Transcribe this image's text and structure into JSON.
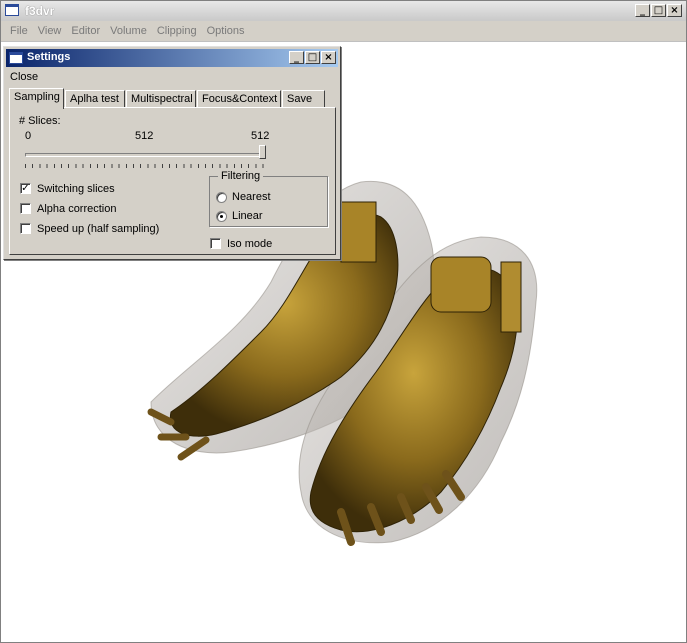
{
  "window": {
    "title": "f3dvr",
    "minimize": "_",
    "maximize": "□",
    "close": "×"
  },
  "menu": [
    "File",
    "View",
    "Editor",
    "Volume",
    "Clipping",
    "Options"
  ],
  "dialog": {
    "title": "Settings",
    "minimize": "_",
    "maximize": "□",
    "close": "×",
    "menu_close": "Close",
    "tabs": [
      "Sampling",
      "Aplha test",
      "Multispectral",
      "Focus&Context",
      "Save"
    ],
    "active_tab": "Sampling",
    "slices_label": "# Slices:",
    "slider": {
      "min_label": "0",
      "value_label": "512",
      "max_label": "512",
      "value_fraction": 1.0
    },
    "checkboxes": [
      {
        "label": "Switching slices",
        "checked": true
      },
      {
        "label": "Alpha correction",
        "checked": false
      },
      {
        "label": "Speed up (half sampling)",
        "checked": false
      }
    ],
    "filtering": {
      "title": "Filtering",
      "options": [
        {
          "label": "Nearest",
          "selected": false
        },
        {
          "label": "Linear",
          "selected": true
        }
      ]
    },
    "iso_mode": {
      "label": "Iso mode",
      "checked": false
    },
    "check_mark": "✓"
  },
  "colors": {
    "bone": "#8a6a1c",
    "bone_highlight": "#c8a43c",
    "skin": "#b8b0a8",
    "dialog_title": "#0a246a"
  }
}
